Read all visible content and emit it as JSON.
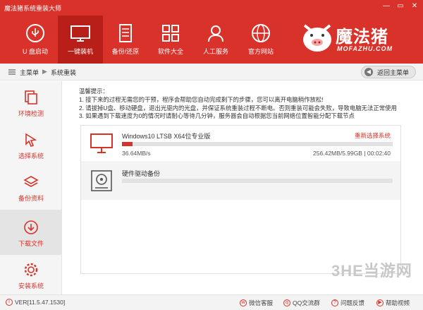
{
  "window": {
    "title": "魔法猪系统重装大师",
    "controls": [
      "—",
      "▭",
      "✕"
    ]
  },
  "nav": [
    {
      "label": "U 盘启动",
      "icon": "usb-icon",
      "active": false
    },
    {
      "label": "一键装机",
      "icon": "monitor-icon",
      "active": true
    },
    {
      "label": "备份/还原",
      "icon": "backup-icon",
      "active": false
    },
    {
      "label": "软件大全",
      "icon": "apps-grid-icon",
      "active": false
    },
    {
      "label": "人工服务",
      "icon": "user-service-icon",
      "active": false
    },
    {
      "label": "官方网站",
      "icon": "globe-icon",
      "active": false
    }
  ],
  "logo": {
    "text": "魔法猪",
    "sub": "MOFAZHU.COM"
  },
  "breadcrumb": {
    "home": "主菜单",
    "current": "系统重装",
    "back_label": "返回主菜单"
  },
  "sidebar": [
    {
      "label": "环境检测",
      "icon": "environment-check-icon"
    },
    {
      "label": "选择系统",
      "icon": "cursor-icon"
    },
    {
      "label": "备份资料",
      "icon": "layers-icon"
    },
    {
      "label": "下载文件",
      "icon": "download-icon"
    },
    {
      "label": "安装系统",
      "icon": "gear-icon"
    }
  ],
  "tips": {
    "heading": "温馨提示：",
    "lines": [
      "1. 接下来的过程无需您的干预，程序会帮助您自动完成剩下的步骤，您可以离开电脑稍作放松!",
      "2. 请拔掉U盘、移动硬盘，退出光驱内的光盘，并保证系统重装过程不断电。否则重装可能会失败，导致电脑无法正常使用",
      "3. 如果遇到下载速度为0的情况时请耐心等待几分钟，服务器会自动根据您当前网络位置智能分配下载节点"
    ]
  },
  "tasks": [
    {
      "name": "Windows10 LTSB X64位专业版",
      "action": "重新选择系统",
      "progress": 0.04,
      "speed": "36.64MB/s",
      "size": "256.42MB/5.99GB | 00:02:40"
    },
    {
      "name": "硬件驱动备份",
      "progress": 0
    }
  ],
  "statusbar": {
    "version": "VER[11.5.47.1530]",
    "links": [
      "微信客服",
      "QQ交流群",
      "问题反馈",
      "帮助视频"
    ]
  },
  "watermark": {
    "text": "3HE当游网"
  },
  "colors": {
    "brand": "#d9322a",
    "accent": "#d6332b"
  }
}
